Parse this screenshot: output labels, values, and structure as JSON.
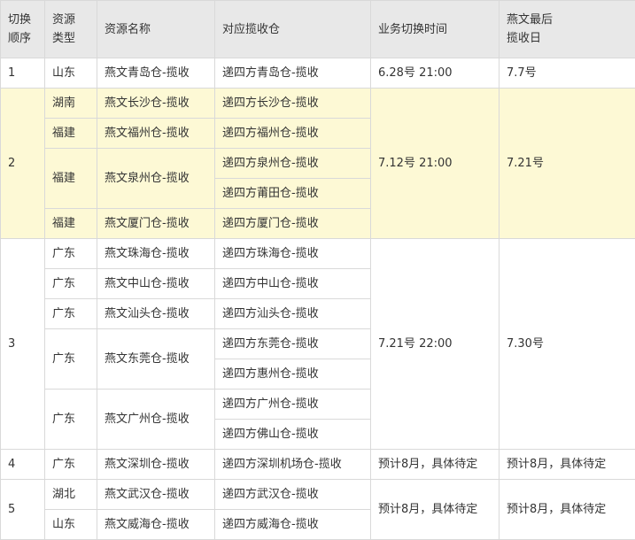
{
  "table": {
    "headers": {
      "order": "切换\n顺序",
      "type": "资源\n类型",
      "name": "资源名称",
      "warehouse": "对应揽收仓",
      "switch_time": "业务切换时间",
      "last_day": "燕文最后\n揽收日"
    },
    "row1": {
      "order": "1",
      "type": "山东",
      "name": "燕文青岛仓-揽收",
      "warehouse": "递四方青岛仓-揽收",
      "switch_time": "6.28号 21:00",
      "last_day": "7.7号"
    },
    "group2": {
      "order": "2",
      "switch_time": "7.12号 21:00",
      "last_day": "7.21号",
      "type1": "湖南",
      "name1": "燕文长沙仓-揽收",
      "wh1": "递四方长沙仓-揽收",
      "type2": "福建",
      "name2": "燕文福州仓-揽收",
      "wh2": "递四方福州仓-揽收",
      "type3": "福建",
      "name3": "燕文泉州仓-揽收",
      "wh3a": "递四方泉州仓-揽收",
      "wh3b": "递四方莆田仓-揽收",
      "type4": "福建",
      "name4": "燕文厦门仓-揽收",
      "wh4": "递四方厦门仓-揽收"
    },
    "group3": {
      "order": "3",
      "switch_time": "7.21号 22:00",
      "last_day": "7.30号",
      "type1": "广东",
      "name1": "燕文珠海仓-揽收",
      "wh1": "递四方珠海仓-揽收",
      "type2": "广东",
      "name2": "燕文中山仓-揽收",
      "wh2": "递四方中山仓-揽收",
      "type3": "广东",
      "name3": "燕文汕头仓-揽收",
      "wh3": "递四方汕头仓-揽收",
      "type4": "广东",
      "name4": "燕文东莞仓-揽收",
      "wh4a": "递四方东莞仓-揽收",
      "wh4b": "递四方惠州仓-揽收",
      "type5": "广东",
      "name5": "燕文广州仓-揽收",
      "wh5a": "递四方广州仓-揽收",
      "wh5b": "递四方佛山仓-揽收"
    },
    "row4": {
      "order": "4",
      "type": "广东",
      "name": "燕文深圳仓-揽收",
      "warehouse": "递四方深圳机场仓-揽收",
      "switch_time": "预计8月，具体待定",
      "last_day": "预计8月，具体待定"
    },
    "group5": {
      "order": "5",
      "switch_time": "预计8月，具体待定",
      "last_day": "预计8月，具体待定",
      "type1": "湖北",
      "name1": "燕文武汉仓-揽收",
      "wh1": "递四方武汉仓-揽收",
      "type2": "山东",
      "name2": "燕文威海仓-揽收",
      "wh2": "递四方威海仓-揽收"
    }
  }
}
